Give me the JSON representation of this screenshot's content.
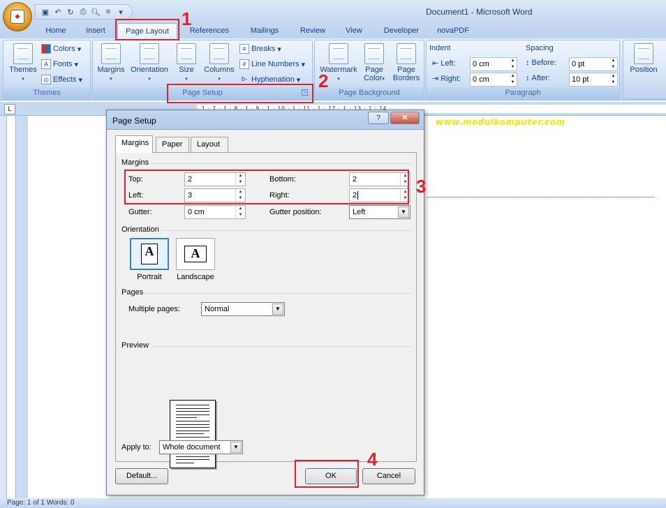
{
  "window": {
    "title": "Document1 - Microsoft Word"
  },
  "quick_access": {
    "icons": [
      "save-icon",
      "undo-icon",
      "redo-icon",
      "print-icon",
      "print-preview-icon",
      "format-icon"
    ]
  },
  "tabs": [
    "Home",
    "Insert",
    "Page Layout",
    "References",
    "Mailings",
    "Review",
    "View",
    "Developer",
    "novaPDF"
  ],
  "active_tab": "Page Layout",
  "ribbon": {
    "themes": {
      "themes_label": "Themes",
      "colors": "Colors",
      "fonts": "Fonts",
      "effects": "Effects",
      "group": "Themes"
    },
    "page_setup": {
      "margins": "Margins",
      "orientation": "Orientation",
      "size": "Size",
      "columns": "Columns",
      "breaks": "Breaks",
      "line_numbers": "Line Numbers",
      "hyphenation": "Hyphenation",
      "group": "Page Setup"
    },
    "page_background": {
      "watermark": "Watermark",
      "page_color": "Page",
      "page_color_2": "Color",
      "page_borders": "Page",
      "page_borders_2": "Borders",
      "group": "Page Background"
    },
    "paragraph": {
      "indent": "Indent",
      "left_label": "Left:",
      "left_value": "0 cm",
      "right_label": "Right:",
      "right_value": "0 cm",
      "spacing": "Spacing",
      "before_label": "Before:",
      "before_value": "0 pt",
      "after_label": "After:",
      "after_value": "10 pt",
      "group": "Paragraph"
    },
    "arrange": {
      "position": "Position"
    }
  },
  "ruler_text": "· 1 · 7 · 1 · 8 · 1 · 9 · 1 · 10 · 1 · 11 · 1 · 12 · 1 · 13 · 1 · 14 ·",
  "watermark_text": "www.modulkomputer.com",
  "dialog": {
    "title": "Page Setup",
    "help": "?",
    "close": "✕",
    "tabs": [
      "Margins",
      "Paper",
      "Layout"
    ],
    "margins_section": "Margins",
    "top_label": "Top:",
    "top_value": "2",
    "bottom_label": "Bottom:",
    "bottom_value": "2",
    "left_label": "Left:",
    "left_value": "3",
    "right_label": "Right:",
    "right_value": "2",
    "gutter_label": "Gutter:",
    "gutter_value": "0 cm",
    "gutter_pos_label": "Gutter position:",
    "gutter_pos_value": "Left",
    "orientation_section": "Orientation",
    "portrait": "Portrait",
    "landscape": "Landscape",
    "pages_section": "Pages",
    "multiple_pages_label": "Multiple pages:",
    "multiple_pages_value": "Normal",
    "preview_section": "Preview",
    "apply_to_label": "Apply to:",
    "apply_to_value": "Whole document",
    "default_button": "Default...",
    "ok_button": "OK",
    "cancel_button": "Cancel"
  },
  "status": {
    "text": "Page: 1 of 1   Words: 0"
  },
  "annotations": {
    "n1": "1",
    "n2": "2",
    "n3": "3",
    "n4": "4",
    "color": "#e0202c"
  }
}
